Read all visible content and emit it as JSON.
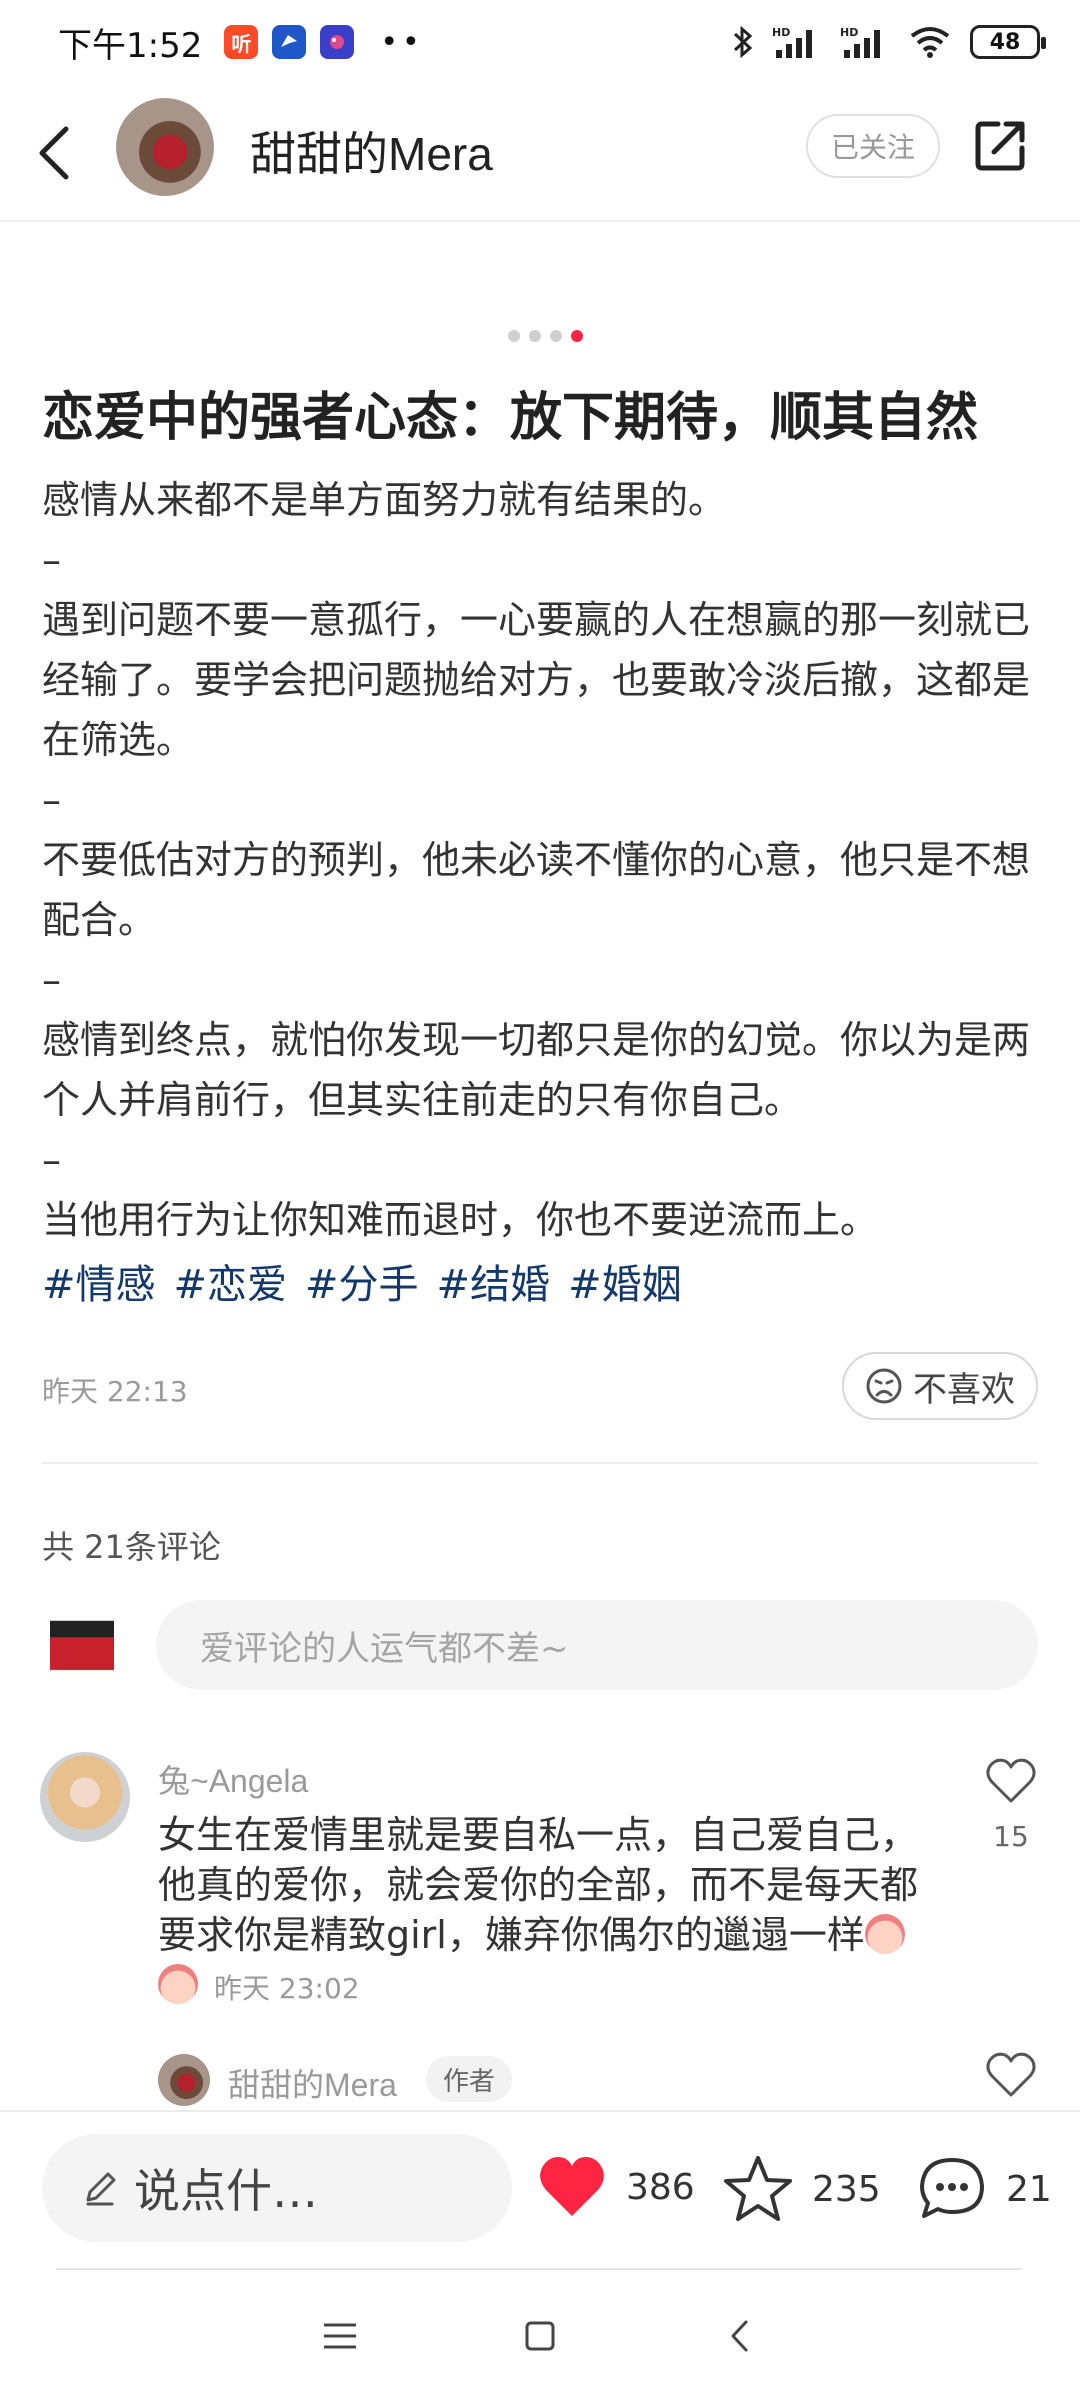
{
  "status_bar": {
    "time": "下午1:52",
    "battery": "48",
    "app_icons": [
      "听",
      "",
      "",
      "••"
    ]
  },
  "header": {
    "author_name": "甜甜的Mera",
    "follow_label": "已关注"
  },
  "post": {
    "page_count": 4,
    "active_page": 4,
    "title": "恋爱中的强者心态：放下期待，顺其自然",
    "paragraphs": [
      "感情从来都不是单方面努力就有结果的。",
      "–",
      "遇到问题不要一意孤行，一心要赢的人在想赢的那一刻就已经输了。要学会把问题抛给对方，也要敢冷淡后撤，这都是在筛选。",
      "–",
      "不要低估对方的预判，他未必读不懂你的心意，他只是不想配合。",
      "–",
      "感情到终点，就怕你发现一切都只是你的幻觉。你以为是两个人并肩前行，但其实往前走的只有你自己。",
      "–",
      "当他用行为让你知难而退时，你也不要逆流而上。"
    ],
    "tags": [
      "#情感",
      "#恋爱",
      "#分手",
      "#结婚",
      "#婚姻"
    ],
    "time": "昨天 22:13",
    "dislike_label": "不喜欢"
  },
  "comments": {
    "count_label": "共 21条评论",
    "input_placeholder": "爱评论的人运气都不差~",
    "items": [
      {
        "user": "兔~Angela",
        "text": "女生在爱情里就是要自私一点，自己爱自己，他真的爱你，就会爱你的全部，而不是每天都要求你是精致girl，嫌弃你偶尔的邋遢一样",
        "time": "昨天 23:02",
        "likes": "15"
      }
    ],
    "reply": {
      "user": "甜甜的Mera",
      "badge": "作者"
    }
  },
  "bottom_bar": {
    "input_label": "说点什…",
    "likes": "386",
    "favorites": "235",
    "comments": "21"
  },
  "colors": {
    "accent": "#ff2442",
    "tag": "#13386c",
    "muted": "#9a9a9a"
  }
}
